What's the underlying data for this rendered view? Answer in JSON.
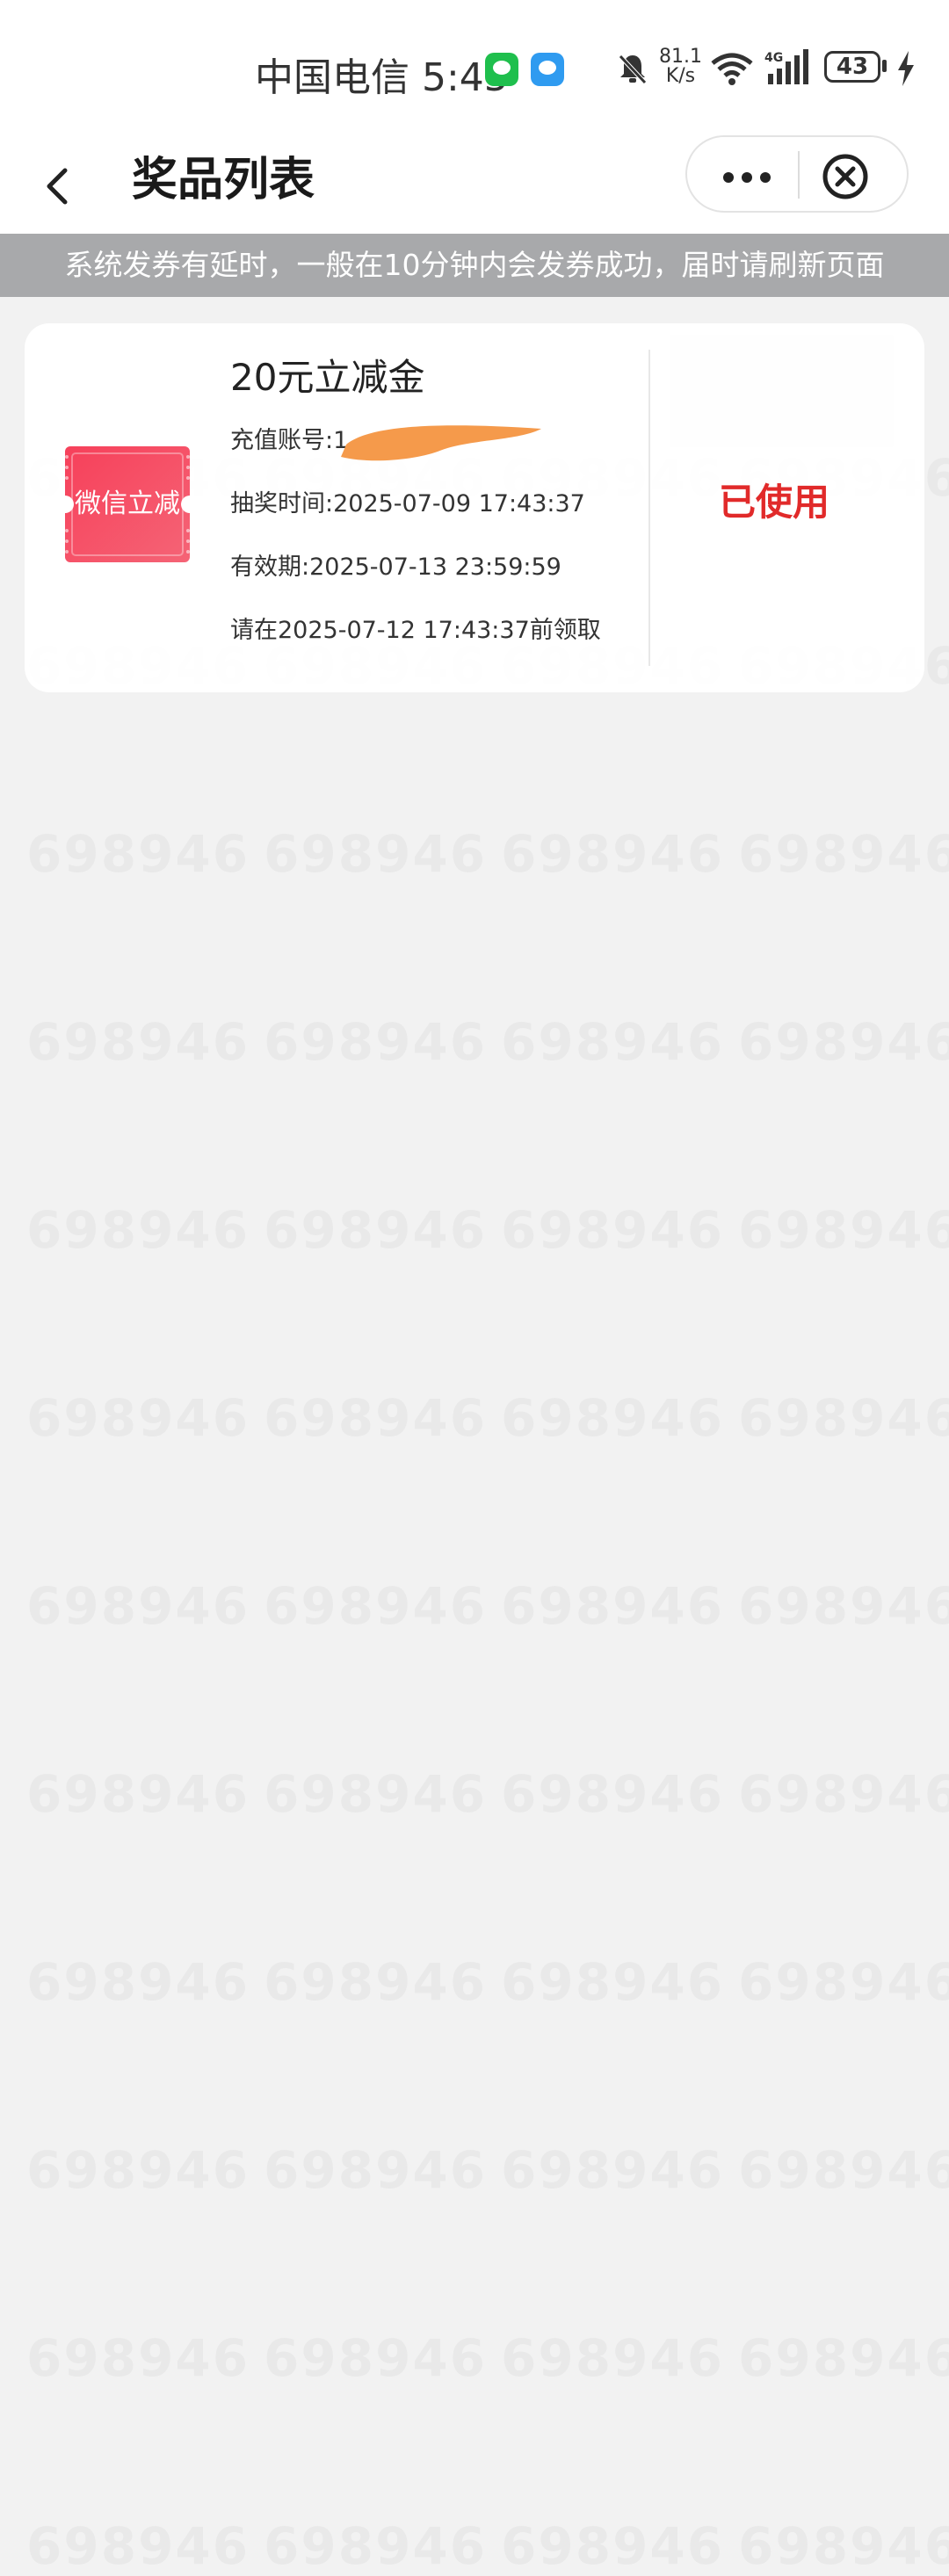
{
  "status_bar": {
    "carrier_time": "中国电信 5:45",
    "net_speed_value": "81.1",
    "net_speed_unit": "K/s",
    "signal_type": "4G",
    "battery": "43"
  },
  "nav": {
    "title": "奖品列表"
  },
  "notice": "系统发券有延时，一般在10分钟内会发券成功，届时请刷新页面",
  "watermark": "698946",
  "prize": {
    "ticket_label": "微信立减金",
    "name": "20元立减金",
    "account": "充值账号:1",
    "draw_time": "抽奖时间:2025-07-09 17:43:37",
    "validity": "有效期:2025-07-13 23:59:59",
    "claim_deadline": "请在2025-07-12 17:43:37前领取",
    "status": "已使用"
  },
  "colors": {
    "accent_red": "#e12a2a",
    "ticket_red": "#f2435a",
    "redaction": "#f59a4b",
    "notice_bg": "#a8a9ab"
  }
}
